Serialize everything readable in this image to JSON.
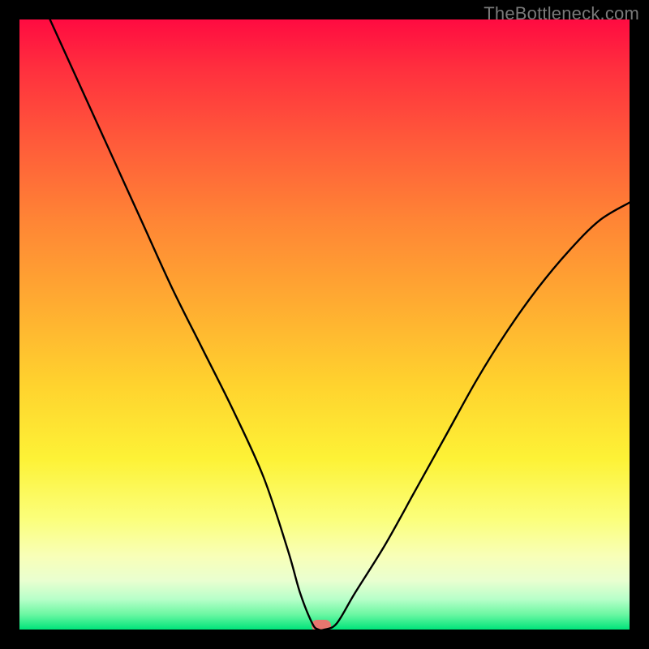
{
  "watermark": "TheBottleneck.com",
  "colors": {
    "page_bg": "#000000",
    "watermark_text": "#7a7a7a",
    "curve_stroke": "#000000",
    "marker_fill": "#e8766f",
    "gradient_stops": [
      "#ff0b41",
      "#ff2f3e",
      "#ff5a3a",
      "#ff8535",
      "#ffad31",
      "#ffd32e",
      "#fdf236",
      "#fbff7c",
      "#f8ffb8",
      "#e9ffd0",
      "#b8ffc9",
      "#6cf7a3",
      "#00e47a"
    ]
  },
  "chart_data": {
    "type": "line",
    "title": "",
    "xlabel": "",
    "ylabel": "",
    "xlim": [
      0,
      100
    ],
    "ylim": [
      0,
      100
    ],
    "grid": false,
    "legend": false,
    "series": [
      {
        "name": "bottleneck-curve",
        "x": [
          5,
          10,
          15,
          20,
          25,
          30,
          35,
          40,
          44,
          46,
          48,
          49,
          50,
          52,
          55,
          60,
          65,
          70,
          75,
          80,
          85,
          90,
          95,
          100
        ],
        "y": [
          100,
          89,
          78,
          67,
          56,
          46,
          36,
          25,
          13,
          6,
          1,
          0,
          0,
          1,
          6,
          14,
          23,
          32,
          41,
          49,
          56,
          62,
          67,
          70
        ]
      }
    ],
    "annotations": [
      {
        "name": "optimal-marker",
        "x": 49.5,
        "y": 0.5,
        "shape": "rounded-rect",
        "color": "#e8766f"
      }
    ]
  }
}
